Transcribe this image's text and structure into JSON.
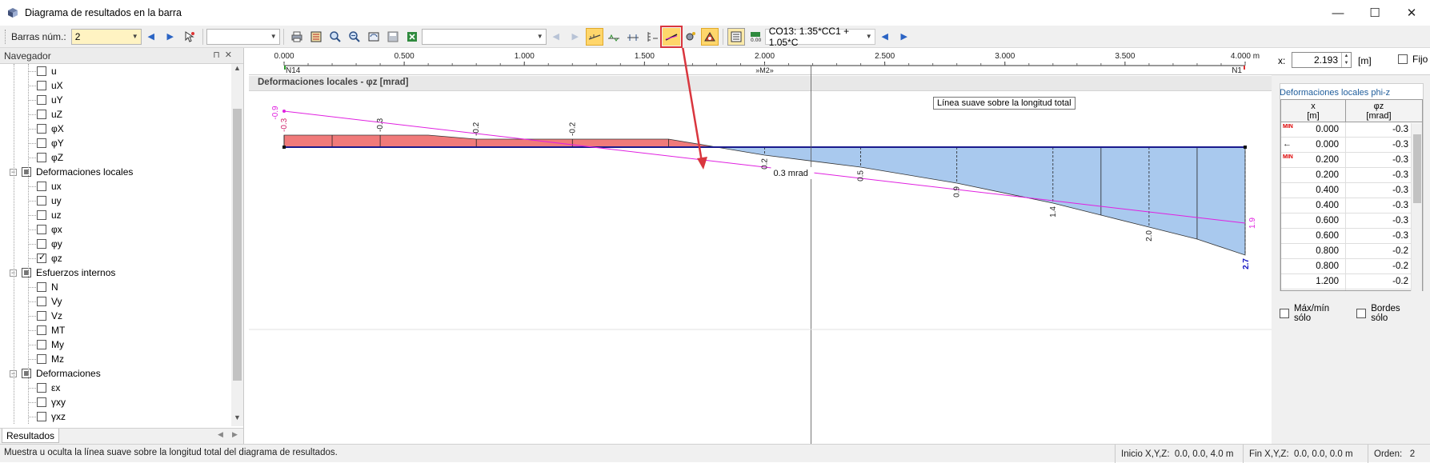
{
  "window": {
    "title": "Diagrama de resultados en la barra",
    "minimize": "—",
    "maximize": "☐",
    "close": "✕"
  },
  "toolbar": {
    "members_label": "Barras núm.:",
    "members_value": "2",
    "combo2_value": "",
    "combo3_value": "",
    "load_case": "CO13: 1.35*CC1 + 1.05*C"
  },
  "navigator": {
    "title": "Navegador",
    "items": [
      {
        "label": "u",
        "checked": false,
        "level": 2
      },
      {
        "label": "uX",
        "checked": false,
        "level": 2
      },
      {
        "label": "uY",
        "checked": false,
        "level": 2
      },
      {
        "label": "uZ",
        "checked": false,
        "level": 2
      },
      {
        "label": "φX",
        "checked": false,
        "level": 2
      },
      {
        "label": "φY",
        "checked": false,
        "level": 2
      },
      {
        "label": "φZ",
        "checked": false,
        "level": 2
      },
      {
        "label": "Deformaciones locales",
        "checked": "partial",
        "level": 1
      },
      {
        "label": "ux",
        "checked": false,
        "level": 2
      },
      {
        "label": "uy",
        "checked": false,
        "level": 2
      },
      {
        "label": "uz",
        "checked": false,
        "level": 2
      },
      {
        "label": "φx",
        "checked": false,
        "level": 2
      },
      {
        "label": "φy",
        "checked": false,
        "level": 2
      },
      {
        "label": "φz",
        "checked": true,
        "level": 2
      },
      {
        "label": "Esfuerzos internos",
        "checked": "partial",
        "level": 1
      },
      {
        "label": "N",
        "checked": false,
        "level": 2
      },
      {
        "label": "Vy",
        "checked": false,
        "level": 2
      },
      {
        "label": "Vz",
        "checked": false,
        "level": 2
      },
      {
        "label": "MT",
        "checked": false,
        "level": 2
      },
      {
        "label": "My",
        "checked": false,
        "level": 2
      },
      {
        "label": "Mz",
        "checked": false,
        "level": 2
      },
      {
        "label": "Deformaciones",
        "checked": "partial",
        "level": 1
      },
      {
        "label": "εx",
        "checked": false,
        "level": 2
      },
      {
        "label": "γxy",
        "checked": false,
        "level": 2
      },
      {
        "label": "γxz",
        "checked": false,
        "level": 2
      }
    ],
    "tab": "Resultados"
  },
  "diagram": {
    "title": "Deformaciones locales - φz [mrad]",
    "tooltip": "Línea suave sobre la longitud total",
    "ruler_ticks": [
      "0.000",
      "0.500",
      "1.000",
      "1.500",
      "2.000",
      "2.500",
      "3.000",
      "3.500",
      "4.000 m"
    ],
    "node_start": "N14",
    "node_end": "N1",
    "member_label": "»M2»",
    "cursor_readout": "0.3 mrad"
  },
  "chart_data": {
    "type": "area",
    "title": "Deformaciones locales - φz [mrad]",
    "xlabel": "",
    "ylabel": "",
    "xlim": [
      0,
      4.0
    ],
    "x": [
      0.0,
      0.2,
      0.4,
      0.6,
      0.8,
      1.2,
      1.6,
      2.0,
      2.4,
      2.8,
      3.2,
      3.4,
      3.6,
      3.8,
      4.0
    ],
    "values": [
      -0.3,
      -0.3,
      -0.3,
      -0.3,
      -0.2,
      -0.2,
      -0.2,
      0.2,
      0.5,
      0.9,
      1.4,
      1.7,
      2.0,
      2.3,
      2.7
    ],
    "value_labels": [
      {
        "x": 0.0,
        "text": "-0.3"
      },
      {
        "x": 0.4,
        "text": "-0.3"
      },
      {
        "x": 0.8,
        "text": "-0.2"
      },
      {
        "x": 1.2,
        "text": "-0.2"
      },
      {
        "x": 2.0,
        "text": "0.2"
      },
      {
        "x": 2.4,
        "text": "0.5"
      },
      {
        "x": 2.8,
        "text": "0.9"
      },
      {
        "x": 3.2,
        "text": "1.4"
      },
      {
        "x": 3.6,
        "text": "2.0"
      },
      {
        "x": 4.0,
        "text": "2.7"
      }
    ],
    "smooth_line": {
      "start": -0.9,
      "end": 1.9
    },
    "cursor_x": 2.193,
    "colors": {
      "negative": "#f07a7a",
      "positive": "#a9c9ee",
      "smooth": "#e020e0",
      "axis": "#1a1a8c",
      "max": "#1010c0"
    }
  },
  "results_panel": {
    "x_label": "x:",
    "x_value": "2.193",
    "x_unit": "[m]",
    "fixed_label": "Fijo",
    "title": "Deformaciones locales phi-z",
    "col_x": "x",
    "col_x_unit": "[m]",
    "col_v": "φz",
    "col_v_unit": "[mrad]",
    "rows": [
      {
        "mark": "MIN",
        "x": "0.000",
        "v": "-0.3"
      },
      {
        "mark": "←",
        "x": "0.000",
        "v": "-0.3"
      },
      {
        "mark": "MIN",
        "x": "0.200",
        "v": "-0.3"
      },
      {
        "mark": "",
        "x": "0.200",
        "v": "-0.3"
      },
      {
        "mark": "",
        "x": "0.400",
        "v": "-0.3"
      },
      {
        "mark": "",
        "x": "0.400",
        "v": "-0.3"
      },
      {
        "mark": "",
        "x": "0.600",
        "v": "-0.3"
      },
      {
        "mark": "",
        "x": "0.600",
        "v": "-0.3"
      },
      {
        "mark": "",
        "x": "0.800",
        "v": "-0.2"
      },
      {
        "mark": "",
        "x": "0.800",
        "v": "-0.2"
      },
      {
        "mark": "",
        "x": "1.200",
        "v": "-0.2"
      },
      {
        "mark": "",
        "x": "1.200",
        "v": "-0.2"
      }
    ],
    "check_maxmin": "Máx/mín sólo",
    "check_edges": "Bordes sólo"
  },
  "status": {
    "message": "Muestra u oculta la línea suave sobre la longitud total del diagrama de resultados.",
    "start_label": "Inicio X,Y,Z:",
    "start_value": "0.0, 0.0, 4.0 m",
    "end_label": "Fin X,Y,Z:",
    "end_value": "0.0, 0.0, 0.0 m",
    "order_label": "Orden:",
    "order_value": "2"
  }
}
